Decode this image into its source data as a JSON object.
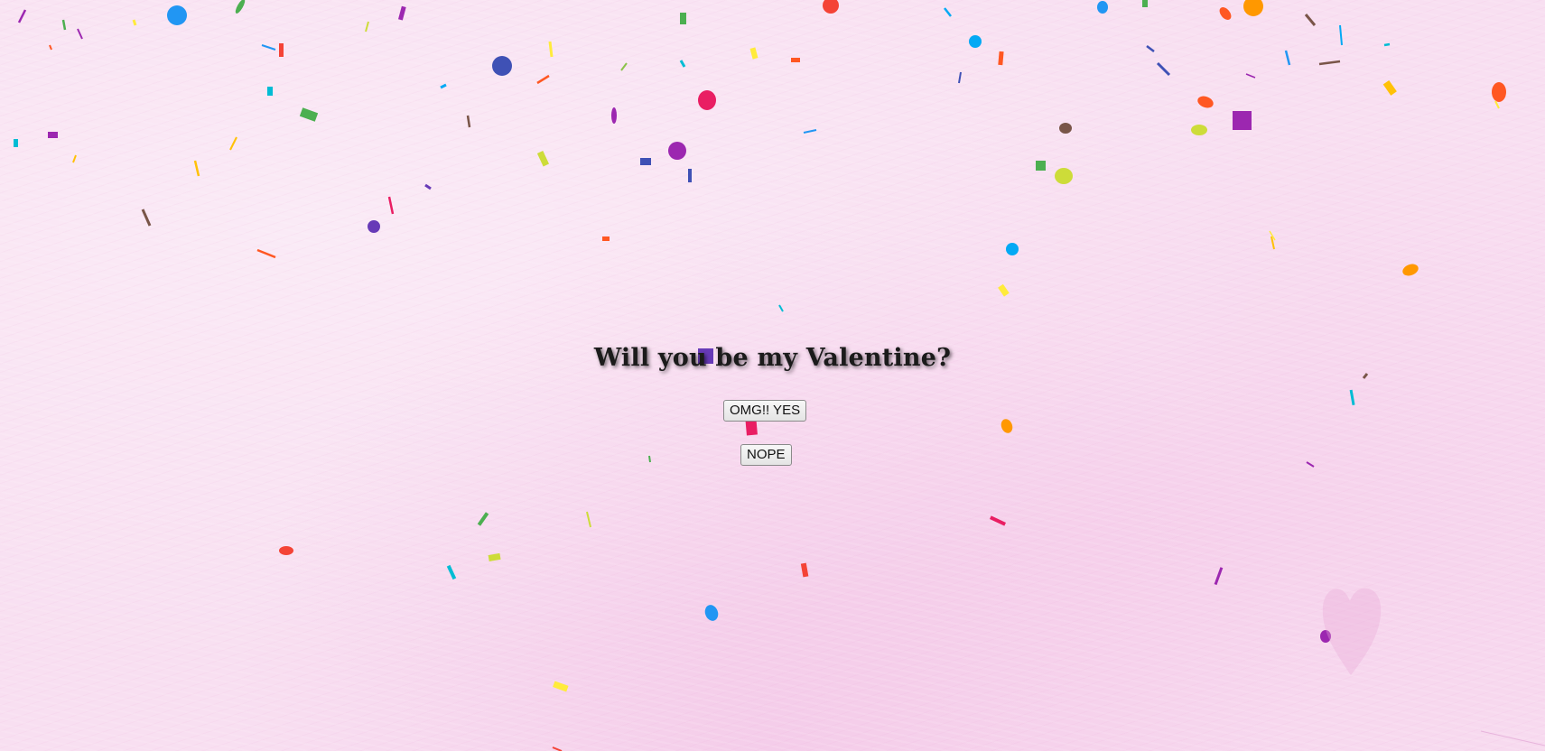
{
  "page": {
    "question": "Will you be my Valentine?",
    "yes_button_label": "OMG!! YES",
    "no_button_label": "NOPE"
  },
  "theme": {
    "background": "#f8dff1",
    "text_color": "#1b1b1b"
  },
  "decorations": {
    "confetti_colors": [
      "#e91e63",
      "#9c27b0",
      "#673ab7",
      "#3f51b5",
      "#2196f3",
      "#03a9f4",
      "#00bcd4",
      "#4caf50",
      "#8bc34a",
      "#cddc39",
      "#ffeb3b",
      "#ffc107",
      "#ff9800",
      "#ff5722",
      "#f44336",
      "#795548"
    ],
    "icon": "heart-watermark"
  }
}
